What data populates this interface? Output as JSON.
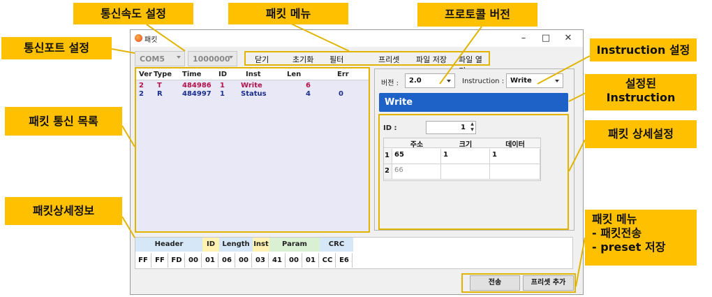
{
  "window": {
    "title": "패킷",
    "buttons": {
      "minimize": "–",
      "maximize": "□",
      "close": "✕"
    }
  },
  "port_combo": "COM5",
  "baud_combo": "1000000",
  "menu": [
    "닫기",
    "초기화",
    "필터",
    "프리셋",
    "파일 저장",
    "파일 열기"
  ],
  "packet_list": {
    "columns": [
      "Ver",
      "Type",
      "Time",
      "ID",
      "Inst",
      "Len",
      "Err"
    ],
    "rows": [
      {
        "ver": "2",
        "type": "T",
        "time": "484986",
        "id": "1",
        "inst": "Write",
        "len": "6",
        "err": "",
        "color": "#b3124a"
      },
      {
        "ver": "2",
        "type": "R",
        "time": "484997",
        "id": "1",
        "inst": "Status",
        "len": "4",
        "err": "0",
        "color": "#1b2f8f"
      }
    ]
  },
  "settings": {
    "version_label": "버전 :",
    "version_value": "2.0",
    "instruction_label": "Instruction :",
    "instruction_value": "Write",
    "banner": "Write",
    "id_label": "ID :",
    "id_value": "1"
  },
  "param_table": {
    "columns": [
      "주소",
      "크기",
      "데이터"
    ],
    "rows": [
      {
        "num": "1",
        "addr": "65",
        "size": "1",
        "data": "1",
        "muted": false
      },
      {
        "num": "2",
        "addr": "66",
        "size": "",
        "data": "",
        "muted": true
      }
    ]
  },
  "packet_info": {
    "header_groups": [
      {
        "label": "Header",
        "color": "#d6e8f7"
      },
      {
        "label": "ID",
        "color": "#fff2b3"
      },
      {
        "label": "Length",
        "color": "#d6e8f7"
      },
      {
        "label": "Inst",
        "color": "#fff2b3"
      },
      {
        "label": "Param",
        "color": "#d9f0d3"
      },
      {
        "label": "CRC",
        "color": "#d6e8f7"
      }
    ],
    "bytes": [
      "FF",
      "FF",
      "FD",
      "00",
      "01",
      "06",
      "00",
      "03",
      "41",
      "00",
      "01",
      "CC",
      "E6"
    ]
  },
  "buttons": {
    "send": "전송",
    "add_preset": "프리셋 추가"
  },
  "callouts": {
    "comm_speed": "통신속도 설정",
    "packet_menu": "패킷 메뉴",
    "protocol_version": "프로토콜 버전",
    "comm_port": "통신포트 설정",
    "instruction_setting": "Instruction 설정",
    "set_instruction": "설정된\nInstruction",
    "packet_list": "패킷 통신 목록",
    "packet_detail_setting": "패킷 상세설정",
    "packet_detail_info": "패킷상세정보",
    "packet_menu2": "패킷 메뉴\n - 패킷전송\n - preset 저장"
  }
}
